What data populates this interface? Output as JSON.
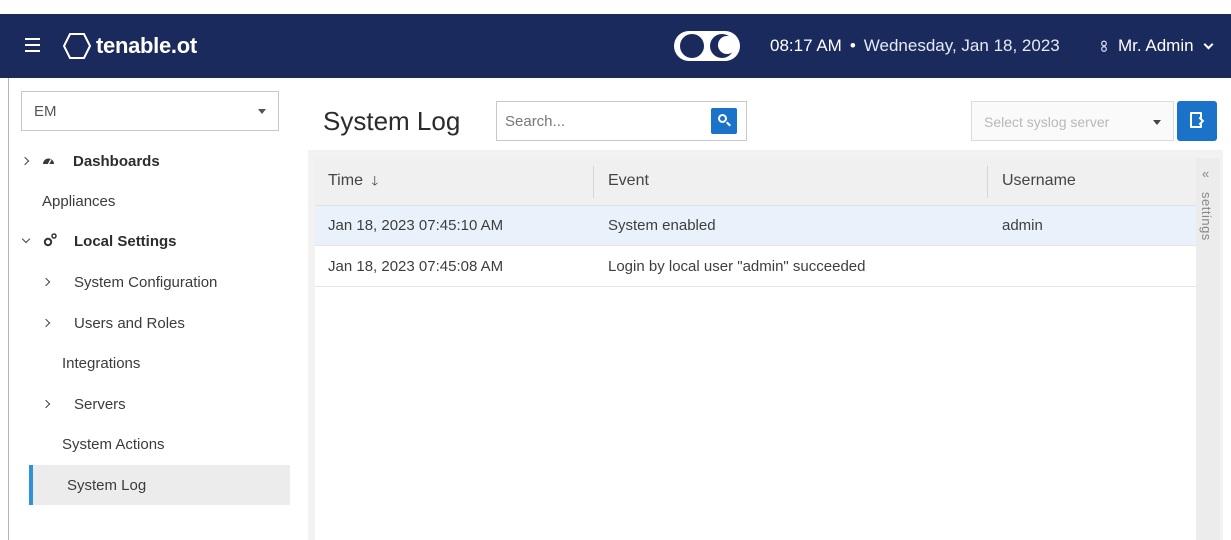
{
  "header": {
    "brand": "tenable.ot",
    "time": "08:17 AM",
    "separator": "•",
    "date": "Wednesday, Jan 18, 2023",
    "user": "Mr. Admin",
    "user_icon": "user-icon",
    "brand_color": "#1b2a5c"
  },
  "sidebar": {
    "site_select": "EM",
    "items": {
      "dashboards": "Dashboards",
      "appliances": "Appliances",
      "local_settings": "Local Settings",
      "system_configuration": "System Configuration",
      "users_and_roles": "Users and Roles",
      "integrations": "Integrations",
      "servers": "Servers",
      "system_actions": "System Actions",
      "system_log": "System Log"
    },
    "active_item": "System Log",
    "accent_color": "#2f91d7"
  },
  "main": {
    "title": "System Log",
    "search_placeholder": "Search...",
    "syslog_placeholder": "Select syslog server",
    "settings_label": "settings",
    "collapse_glyph": "«",
    "columns": {
      "time": "Time",
      "sort_arrow": "🡓",
      "event": "Event",
      "username": "Username"
    },
    "rows": [
      {
        "time": "Jan 18, 2023 07:45:10 AM",
        "event": "System enabled",
        "username": "admin",
        "selected": true
      },
      {
        "time": "Jan 18, 2023 07:45:08 AM",
        "event": "Login by local user \"admin\" succeeded",
        "username": "",
        "selected": false
      }
    ],
    "button_color": "#1a73c8"
  }
}
